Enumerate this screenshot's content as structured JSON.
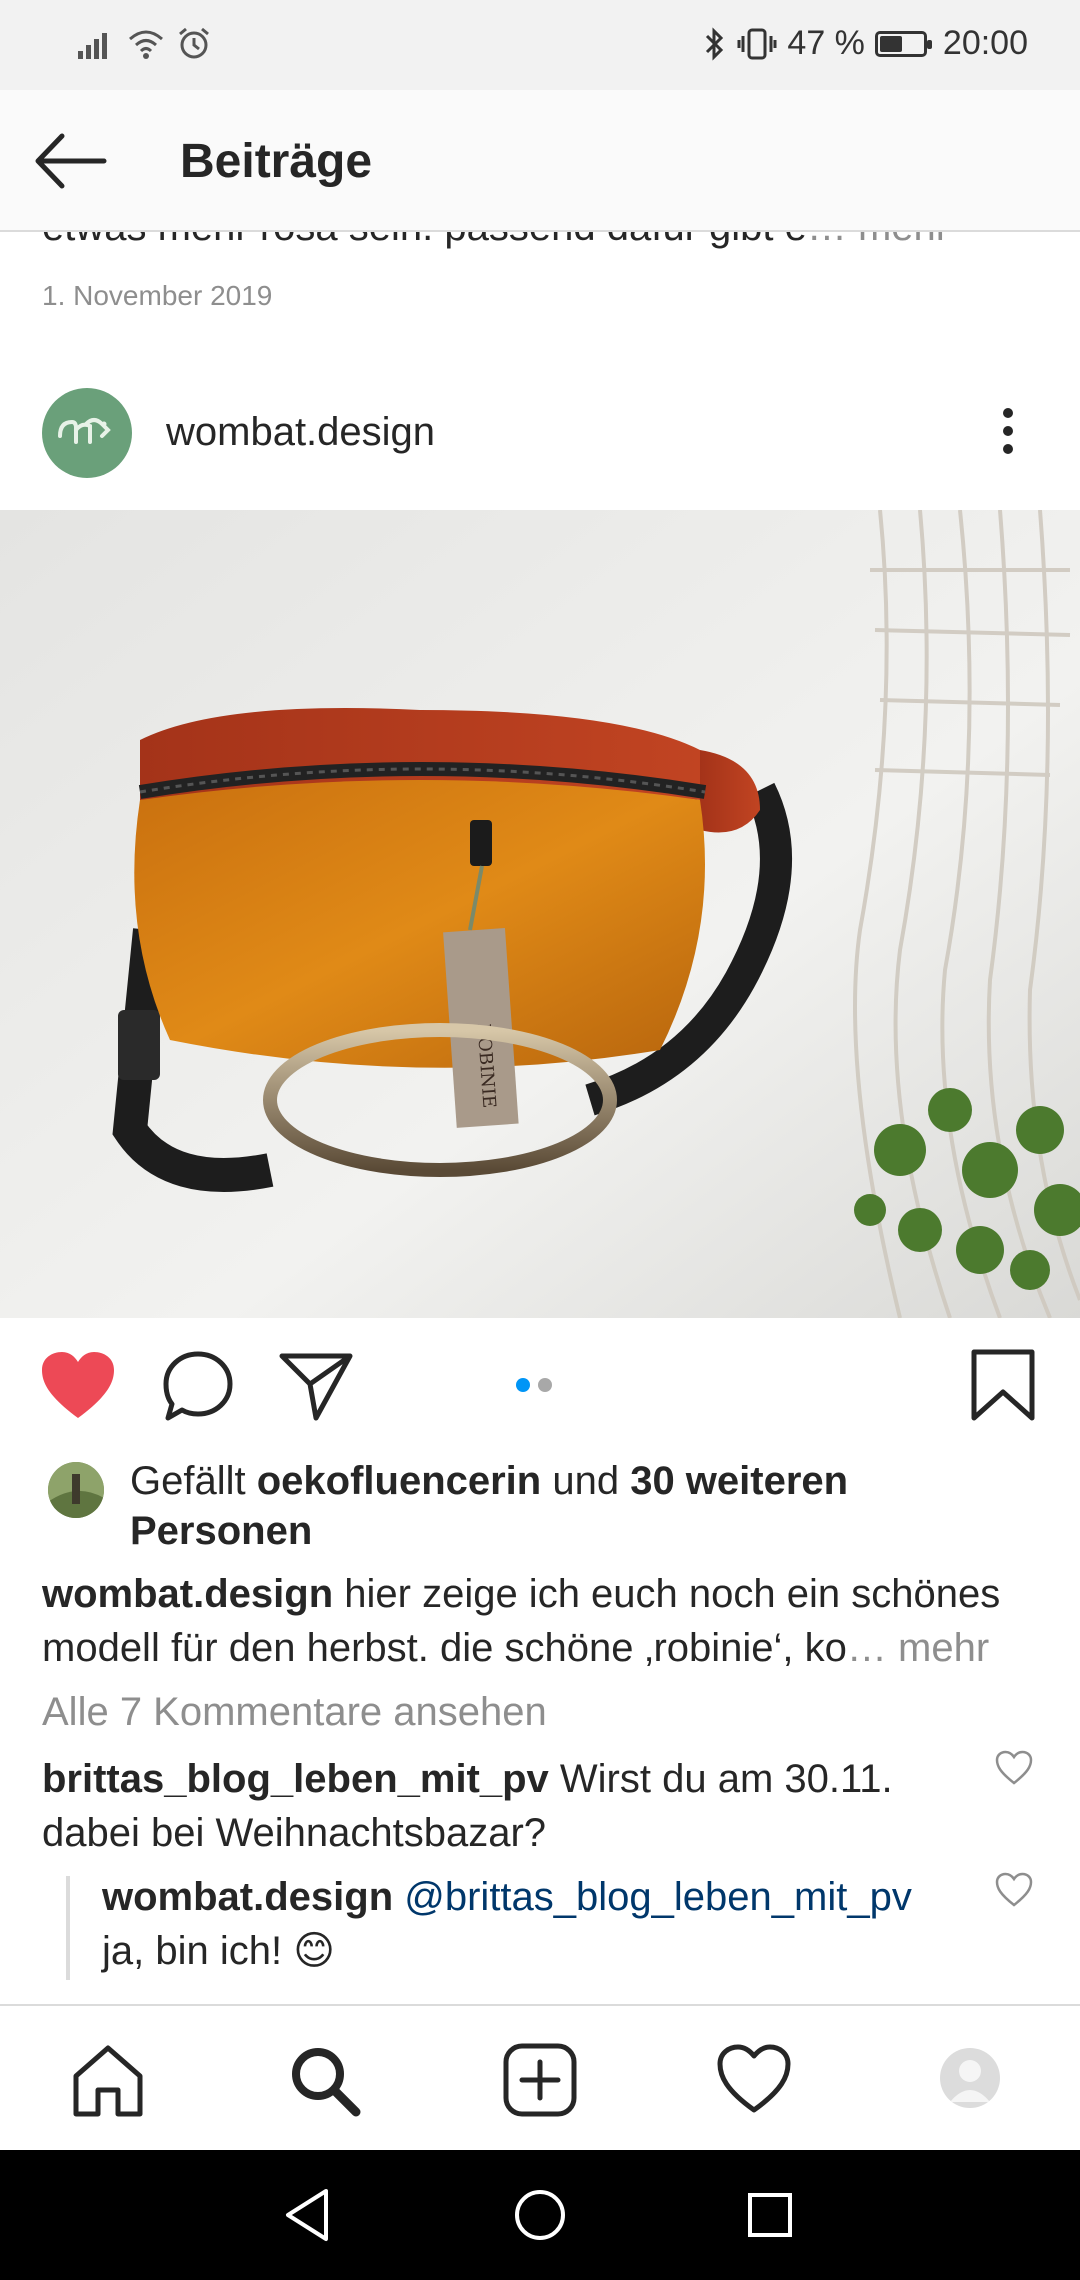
{
  "status_bar": {
    "battery_percent": "47 %",
    "battery_level": 0.47,
    "time": "20:00"
  },
  "header": {
    "title": "Beiträge"
  },
  "previous_post": {
    "caption_snippet": "etwas mehr rosa sein. passend dafür gibt e",
    "more": "… mehr",
    "date": "1. November 2019"
  },
  "post": {
    "username": "wombat.design",
    "image_tag_text": "ROBINIE",
    "carousel": {
      "count": 2,
      "active_index": 0
    },
    "likes": {
      "prefix": "Gefällt ",
      "user": "oekofluencerin",
      "middle": " und ",
      "count_text": "30 weiteren Personen"
    },
    "caption": {
      "user": "wombat.design",
      "text": " hier zeige ich euch noch ein schönes modell für den herbst. die schöne ‚robinie‘, ko",
      "more": "… mehr"
    },
    "view_comments": "Alle 7 Kommentare ansehen",
    "comments": [
      {
        "user": "brittas_blog_leben_mit_pv",
        "text": " Wirst du am 30.11. dabei bei Weihnachtsbazar?"
      },
      {
        "user": "wombat.design",
        "mention": " @brittas_blog_leben_mit_pv",
        "text": " ja, bin ich! 😊"
      }
    ]
  },
  "colors": {
    "like_red": "#ed4956",
    "carousel_active": "#0095f6",
    "muted": "#8e8e8e"
  },
  "icons": [
    "signal-icon",
    "wifi-icon",
    "alarm-icon",
    "bluetooth-icon",
    "vibrate-icon",
    "battery-icon",
    "back-arrow-icon",
    "more-vertical-icon",
    "heart-filled-icon",
    "comment-icon",
    "share-icon",
    "bookmark-icon",
    "home-icon",
    "search-icon",
    "add-post-icon",
    "activity-heart-icon",
    "profile-avatar-icon",
    "back-triangle-icon",
    "home-circle-icon",
    "recents-square-icon"
  ]
}
